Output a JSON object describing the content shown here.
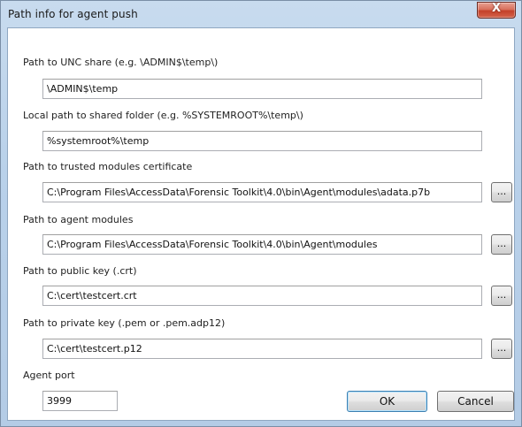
{
  "window": {
    "title": "Path info for agent push",
    "close_glyph": "X"
  },
  "fields": [
    {
      "label": "Path to UNC share (e.g. \\ADMIN$\\temp\\)",
      "value": "\\ADMIN$\\temp"
    },
    {
      "label": "Local path to shared folder (e.g. %SYSTEMROOT%\\temp\\)",
      "value": "%systemroot%\\temp"
    },
    {
      "label": "Path to trusted modules certificate",
      "value": "C:\\Program Files\\AccessData\\Forensic Toolkit\\4.0\\bin\\Agent\\modules\\adata.p7b"
    },
    {
      "label": "Path to agent modules",
      "value": "C:\\Program Files\\AccessData\\Forensic Toolkit\\4.0\\bin\\Agent\\modules"
    },
    {
      "label": "Path to public key (.crt)",
      "value": "C:\\cert\\testcert.crt"
    },
    {
      "label": "Path to private key (.pem or .pem.adp12)",
      "value": "C:\\cert\\testcert.p12"
    }
  ],
  "browse_label": "...",
  "agent_port": {
    "label": "Agent port",
    "value": "3999"
  },
  "buttons": {
    "ok": "OK",
    "cancel": "Cancel"
  },
  "colors": {
    "title_bar": "#b9d1ea",
    "close_button": "#c4412a",
    "default_button_border": "#3c7fb1"
  }
}
